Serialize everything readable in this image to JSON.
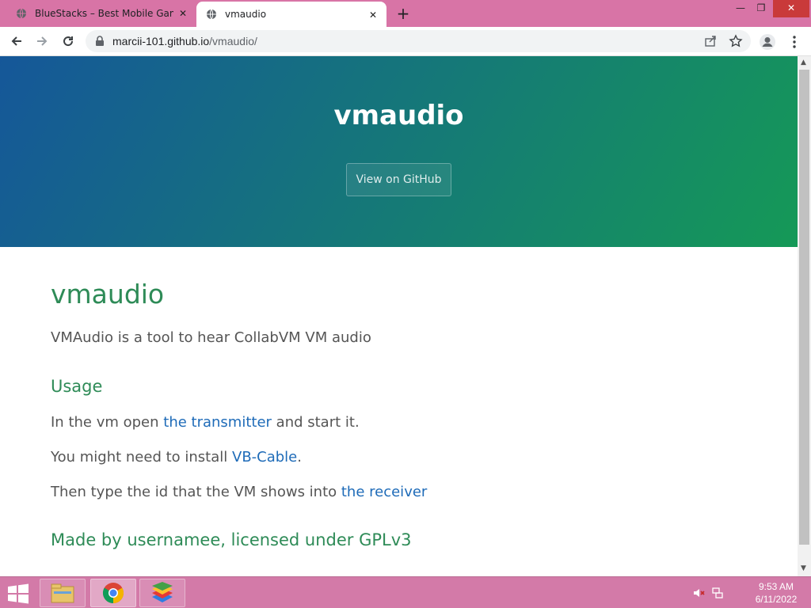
{
  "browser": {
    "tabs": [
      {
        "title": "BlueStacks – Best Mobile Gaming",
        "active": false
      },
      {
        "title": "vmaudio",
        "active": true
      }
    ],
    "url_host": "marcii-101.github.io",
    "url_path": "/vmaudio/"
  },
  "page": {
    "hero_title": "vmaudio",
    "github_button": "View on GitHub",
    "heading": "vmaudio",
    "intro": "VMAudio is a tool to hear CollabVM VM audio",
    "usage_heading": "Usage",
    "line1_before": "In the vm open ",
    "line1_link": "the transmitter",
    "line1_after": " and start it.",
    "line2_before": "You might need to install ",
    "line2_link": "VB-Cable",
    "line2_after": ".",
    "line3_before": "Then type the id that the VM shows into ",
    "line3_link": "the receiver",
    "footer_heading": "Made by usernamee, licensed under GPLv3"
  },
  "taskbar": {
    "time": "9:53 AM",
    "date": "6/11/2022"
  },
  "colors": {
    "tabstrip": "#d874a6",
    "taskbar": "#d37aa8",
    "hero_start": "#155799",
    "hero_end": "#159957",
    "heading_green": "#2e8b57",
    "link_blue": "#1e6bb8"
  }
}
